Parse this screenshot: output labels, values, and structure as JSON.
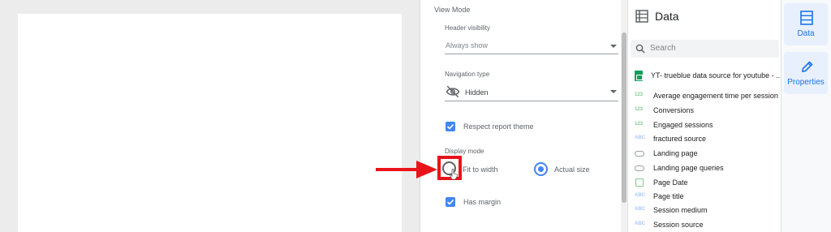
{
  "settings": {
    "section_title": "View Mode",
    "header_visibility": {
      "label": "Header visibility",
      "value": "Always show"
    },
    "navigation_type": {
      "label": "Navigation type",
      "value": "Hidden"
    },
    "respect_theme": {
      "label": "Respect report theme",
      "checked": true
    },
    "display_mode": {
      "label": "Display mode",
      "options": [
        {
          "label": "Fit to width",
          "selected": false
        },
        {
          "label": "Actual size",
          "selected": true
        }
      ]
    },
    "has_margin": {
      "label": "Has margin",
      "checked": true
    }
  },
  "data_panel": {
    "title": "Data",
    "search_placeholder": "Search",
    "source_name": "YT- trueblue data source for youtube - ...",
    "fields": [
      {
        "type": "123",
        "name": "Average engagement time per session"
      },
      {
        "type": "123",
        "name": "Conversions"
      },
      {
        "type": "123",
        "name": "Engaged sessions"
      },
      {
        "type": "ABC",
        "name": "fractured source"
      },
      {
        "type": "link",
        "name": "Landing page"
      },
      {
        "type": "link",
        "name": "Landing page queries"
      },
      {
        "type": "date",
        "name": "Page Date"
      },
      {
        "type": "ABC",
        "name": "Page title"
      },
      {
        "type": "ABC",
        "name": "Session medium"
      },
      {
        "type": "ABC",
        "name": "Session source"
      }
    ]
  },
  "side_rail": {
    "data_label": "Data",
    "properties_label": "Properties"
  },
  "colors": {
    "accent": "#4285f4",
    "annotation_red": "#e8141a",
    "sheets_green": "#0f9d58"
  },
  "icons": [
    "eye-off-icon",
    "check-icon",
    "table-icon",
    "search-icon",
    "sheets-icon",
    "pencil-icon",
    "cursor-icon",
    "arrow-icon"
  ]
}
